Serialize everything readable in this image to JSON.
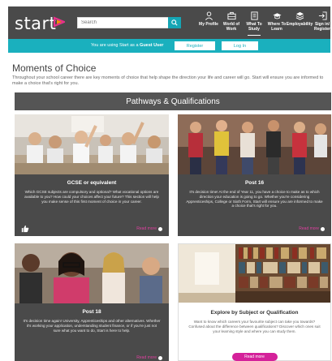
{
  "header": {
    "logo_text": "start",
    "search_placeholder": "Search",
    "nav": [
      {
        "label_line1": "My Profile",
        "label_line2": "",
        "icon": "person-icon"
      },
      {
        "label_line1": "World of",
        "label_line2": "Work",
        "icon": "briefcase-icon"
      },
      {
        "label_line1": "What To",
        "label_line2": "Study",
        "icon": "book-icon"
      },
      {
        "label_line1": "Where To",
        "label_line2": "Learn",
        "icon": "graduation-cap-icon"
      },
      {
        "label_line1": "Employability",
        "label_line2": "",
        "icon": "layers-icon"
      },
      {
        "label_line1": "Sign in/",
        "label_line2": "Register",
        "icon": "sign-in-icon"
      }
    ]
  },
  "guestbar": {
    "text_prefix": "You are using Start as a",
    "text_bold": "Guest User",
    "register_label": "Register",
    "login_label": "Log In"
  },
  "intro": {
    "title": "Moments of Choice",
    "text": "Throughout your school career there are key moments of choice that help shape the direction your life and career will go. Start will ensure you are informed to make a choice that's right for you."
  },
  "section": {
    "title": "Pathways & Qualifications"
  },
  "cards": [
    {
      "title": "GCSE or equivalent",
      "text": "Which GCSE subjects are compulsory and optional? What vocational options are available to you? How could your choices affect your future? This section will help you make sense of this first moment of choice in your career.",
      "read_more": "Read more"
    },
    {
      "title": "Post 16",
      "text": "It's decision time! At the end of Year 11, you have a choice to make as to which direction your education is going to go. Whether you're considering Apprenticeships, College or Sixth Form, Start will ensure you are informed to make a choice that's right for you.",
      "read_more": "Read more"
    },
    {
      "title": "Post 18",
      "text": "It's decision time again! University, Apprenticeships and other alternatives. Whether it's working your application, understanding student finance, or if you're just not sure what you want to do, Start is here to help.",
      "read_more": "Read more"
    },
    {
      "title": "Explore by Subject or Qualification",
      "text": "Want to know which careers your favourite subject can take you towards? Confused about the difference between qualifications? Discover which ones suit your learning style and where you can study them.",
      "read_more": "Read more"
    }
  ],
  "colors": {
    "header_bg": "#4a4a4a",
    "accent_teal": "#1ab0be",
    "accent_pink": "#d4219a",
    "card_bg": "#4a4a4a"
  }
}
